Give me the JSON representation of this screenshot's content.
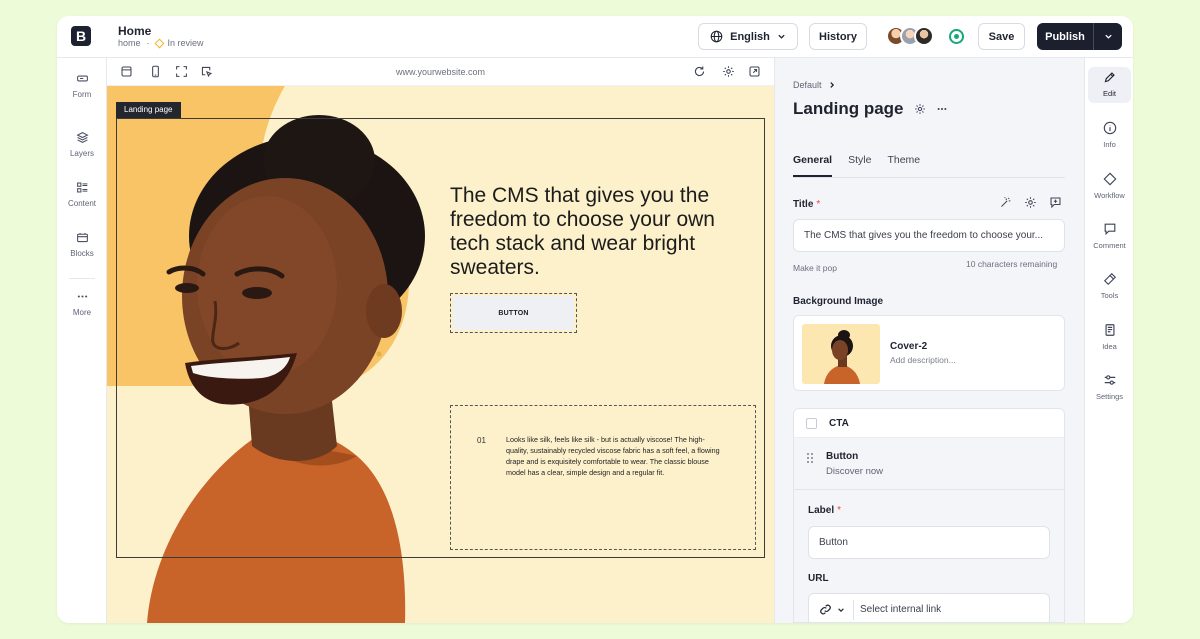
{
  "header": {
    "title": "Home",
    "breadcrumb": "home",
    "separator": "·",
    "status": "In review",
    "language": "English",
    "history": "History",
    "save": "Save",
    "publish": "Publish"
  },
  "left_rail": {
    "items": [
      {
        "label": "Form",
        "icon": "form-icon"
      },
      {
        "label": "Layers",
        "icon": "layers-icon"
      },
      {
        "label": "Content",
        "icon": "content-icon"
      },
      {
        "label": "Blocks",
        "icon": "blocks-icon"
      },
      {
        "label": "More",
        "icon": "more-icon"
      }
    ]
  },
  "canvas": {
    "url": "www.yourwebsite.com",
    "frame_tag": "Landing page",
    "headline": "The CMS that gives you the freedom to choose your own tech stack and wear bright sweaters.",
    "button_text": "BUTTON",
    "item_number": "01",
    "description": "Looks like silk, feels like silk - but is actually viscose! The high-quality, sustainably recycled viscose fabric has a soft feel, a flowing drape and is exquisitely comfortable to wear. The classic blouse model has a clear, simple design and a regular fit."
  },
  "panel": {
    "breadcrumb": "Default",
    "title": "Landing page",
    "tabs": [
      "General",
      "Style",
      "Theme"
    ],
    "title_field": {
      "label": "Title",
      "required": "*",
      "value": "The CMS that gives you the freedom to choose your...",
      "hint": "Make it pop",
      "remaining": "10 characters remaining"
    },
    "background_image": {
      "label": "Background Image",
      "name": "Cover-2",
      "description": "Add description..."
    },
    "cta": {
      "title": "CTA",
      "button_title": "Button",
      "button_subtitle": "Discover now",
      "label_field": "Label",
      "required": "*",
      "label_value": "Button",
      "url_field": "URL",
      "url_placeholder": "Select internal link"
    }
  },
  "right_rail": {
    "items": [
      {
        "label": "Edit",
        "icon": "pencil-icon",
        "active": true
      },
      {
        "label": "Info",
        "icon": "info-icon"
      },
      {
        "label": "Workflow",
        "icon": "workflow-icon"
      },
      {
        "label": "Comment",
        "icon": "comment-icon"
      },
      {
        "label": "Tools",
        "icon": "tools-icon"
      },
      {
        "label": "Idea",
        "icon": "idea-icon"
      },
      {
        "label": "Settings",
        "icon": "settings-icon"
      }
    ]
  },
  "colors": {
    "page_bg": "#eefbd9",
    "canvas_bg": "#fdf1cc",
    "accent_shape": "#f8c466",
    "publish_bg": "#1b1f2e",
    "live_green": "#15a87a",
    "status_yellow": "#f0b429"
  }
}
